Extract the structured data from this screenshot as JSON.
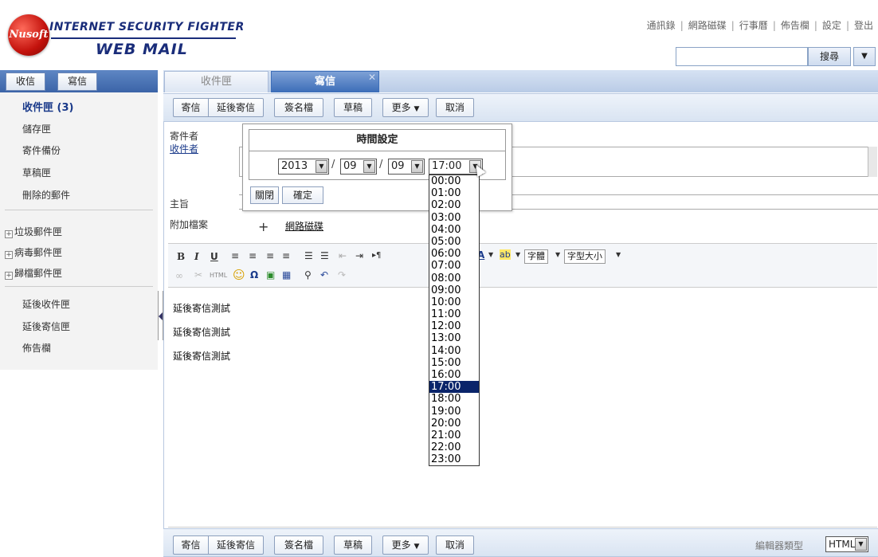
{
  "header": {
    "logo_ball_text": "Nusoft",
    "logo_line1": "INTERNET SECURITY FIGHTER",
    "logo_line2": "WEB MAIL",
    "links": [
      "通訊錄",
      "網路磁碟",
      "行事曆",
      "佈告欄",
      "設定",
      "登出"
    ],
    "search_button": "搜尋",
    "search_placeholder": ""
  },
  "left_nav": {
    "receive_button": "收信",
    "compose_button": "寫信",
    "folders": [
      "收件匣 (3)",
      "儲存匣",
      "寄件備份",
      "草稿匣",
      "刪除的郵件"
    ],
    "collapsible": [
      "垃圾郵件匣",
      "病毒郵件匣",
      "歸檔郵件匣"
    ],
    "extra": [
      "延後收件匣",
      "延後寄信匣",
      "佈告欄"
    ]
  },
  "tabs": [
    {
      "label": "收件匣",
      "active": false
    },
    {
      "label": "寫信",
      "active": true
    }
  ],
  "toolbar": {
    "send": "寄信",
    "delay_send": "延後寄信",
    "signature": "簽名檔",
    "draft": "草稿",
    "more": "更多",
    "cancel": "取消"
  },
  "form": {
    "sender_label": "寄件者",
    "recipient_label": "收件者",
    "subject_label": "主旨",
    "attachment_label": "附加檔案",
    "attach_plus": "+",
    "attach_drive": "網路磁碟"
  },
  "editor_toolbar": {
    "font_label": "字體",
    "size_label": "字型大小",
    "html_label": "HTML"
  },
  "editor_body": [
    "延後寄信測試",
    "延後寄信測試",
    "延後寄信測試"
  ],
  "time_popup": {
    "title": "時間設定",
    "year": "2013",
    "month": "09",
    "day": "09",
    "time": "17:00",
    "close_button": "關閉",
    "confirm_button": "確定",
    "hours": [
      "00:00",
      "01:00",
      "02:00",
      "03:00",
      "04:00",
      "05:00",
      "06:00",
      "07:00",
      "08:00",
      "09:00",
      "10:00",
      "11:00",
      "12:00",
      "13:00",
      "14:00",
      "15:00",
      "16:00",
      "17:00",
      "18:00",
      "19:00",
      "20:00",
      "21:00",
      "22:00",
      "23:00"
    ],
    "selected_hour": "17:00"
  },
  "footer": {
    "editor_type_label": "編輯器類型",
    "editor_type_value": "HTML"
  },
  "colors": {
    "accent": "#3e6fb9",
    "selected": "#0a246a"
  }
}
